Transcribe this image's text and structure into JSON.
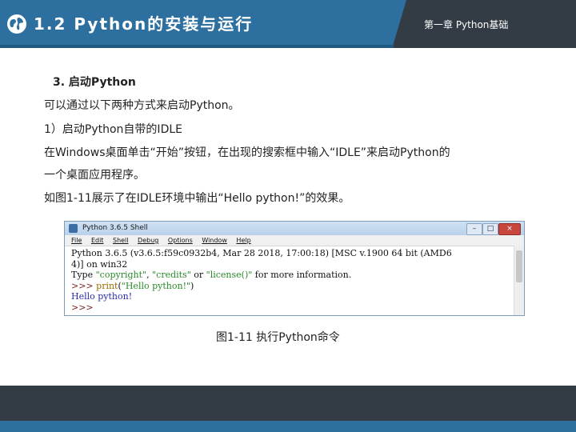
{
  "header": {
    "section_title": "1.2 Python的安装与运行",
    "chapter": "第一章 Python基础",
    "colors": {
      "title_bar": "#2d6f9e",
      "header_dark": "#333b45"
    }
  },
  "content": {
    "subheading": "3. 启动Python",
    "lines": [
      "可以通过以下两种方式来启动Python。",
      "1）启动Python自带的IDLE",
      "在Windows桌面单击“开始”按钮，在出现的搜索框中输入“IDLE”来启动Python的",
      "一个桌面应用程序。",
      "如图1-11展示了在IDLE环境中输出“Hello python!”的效果。"
    ]
  },
  "idle": {
    "window_title": "Python 3.6.5 Shell",
    "window_buttons": {
      "minimize": "–",
      "maximize": "□",
      "close": "×"
    },
    "menu": [
      "File",
      "Edit",
      "Shell",
      "Debug",
      "Options",
      "Window",
      "Help"
    ],
    "console": {
      "banner_1": "Python 3.6.5 (v3.6.5:f59c0932b4, Mar 28 2018, 17:00:18) [MSC v.1900 64 bit (AMD6",
      "banner_2": "4)] on win32",
      "banner_3_kw1": "Type ",
      "banner_3_s1": "\"copyright\"",
      "banner_3_sep1": ", ",
      "banner_3_s2": "\"credits\"",
      "banner_3_or": " or ",
      "banner_3_s3": "\"license()\"",
      "banner_3_rest": " for more information.",
      "prompt": ">>> ",
      "cmd_fn": "print",
      "cmd_open": "(",
      "cmd_str": "\"Hello python!\"",
      "cmd_close": ")",
      "output": "Hello python!",
      "prompt_last": ">>>"
    }
  },
  "figure_caption": "图1-11  执行Python命令"
}
